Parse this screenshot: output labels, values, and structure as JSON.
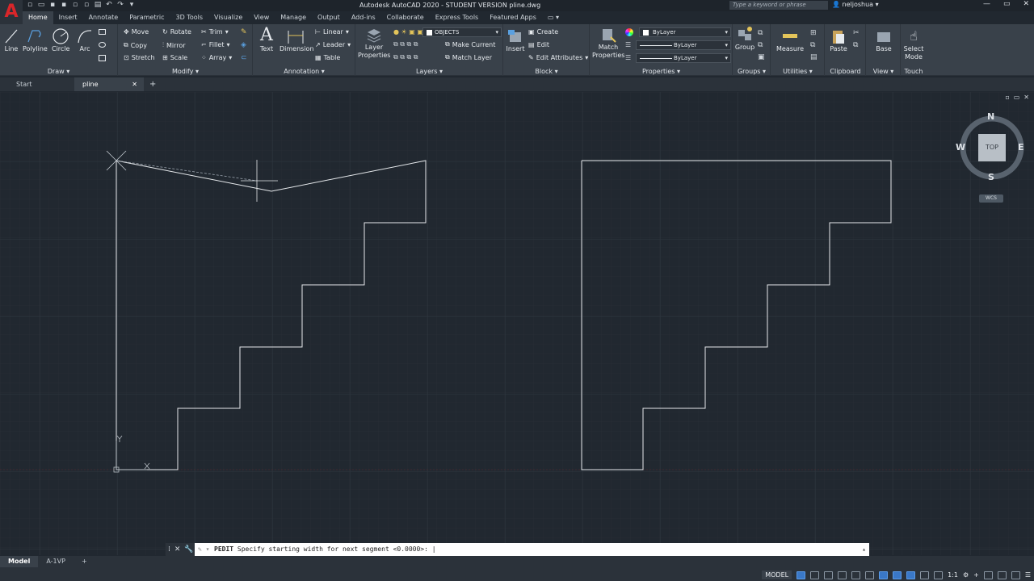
{
  "app": {
    "title": "Autodesk AutoCAD 2020 - STUDENT VERSION    pline.dwg",
    "logo_letter": "A",
    "search_placeholder": "Type a keyword or phrase",
    "user": "neljoshua"
  },
  "ribbon_tabs": [
    "Home",
    "Insert",
    "Annotate",
    "Parametric",
    "3D Tools",
    "Visualize",
    "View",
    "Manage",
    "Output",
    "Add-ins",
    "Collaborate",
    "Express Tools",
    "Featured Apps"
  ],
  "active_tab": "Home",
  "panels": {
    "draw": {
      "label": "Draw",
      "tools": [
        "Line",
        "Polyline",
        "Circle",
        "Arc"
      ]
    },
    "modify": {
      "label": "Modify",
      "tools": [
        "Move",
        "Rotate",
        "Trim",
        "Copy",
        "Mirror",
        "Fillet",
        "Stretch",
        "Scale",
        "Array"
      ]
    },
    "annotation": {
      "label": "Annotation",
      "tools": [
        "Text",
        "Dimension",
        "Linear",
        "Leader",
        "Table"
      ]
    },
    "layers": {
      "label": "Layers",
      "layer_properties": "Layer\nProperties",
      "current_layer": "OBJECTS",
      "make_current": "Make Current",
      "match_layer": "Match Layer"
    },
    "block": {
      "label": "Block",
      "insert": "Insert",
      "create": "Create",
      "edit": "Edit",
      "edit_attributes": "Edit Attributes"
    },
    "properties": {
      "label": "Properties",
      "match_properties": "Match\nProperties",
      "color": "ByLayer",
      "lineweight": "ByLayer",
      "linetype": "ByLayer"
    },
    "groups": {
      "label": "Groups",
      "group": "Group"
    },
    "utilities": {
      "label": "Utilities",
      "measure": "Measure"
    },
    "clipboard": {
      "label": "Clipboard",
      "paste": "Paste"
    },
    "view": {
      "label": "View",
      "base": "Base"
    },
    "touch": {
      "label": "Touch",
      "select_mode": "Select\nMode"
    }
  },
  "doc_tabs": [
    "Start",
    "pline"
  ],
  "active_doc": "pline",
  "viewcube": {
    "n": "N",
    "s": "S",
    "e": "E",
    "w": "W",
    "face": "TOP",
    "wcs": "WCS"
  },
  "command": {
    "prefix": "PEDIT",
    "prompt": "Specify starting width for next segment <0.0000>:"
  },
  "layout_tabs": [
    "Model",
    "A-1VP"
  ],
  "active_layout": "Model",
  "status": {
    "model": "MODEL",
    "scale": "1:1"
  },
  "colors": {
    "canvas": "#212830",
    "ribbon": "#39414a",
    "linework": "#e6e9ec",
    "grid": "#2a323b"
  }
}
